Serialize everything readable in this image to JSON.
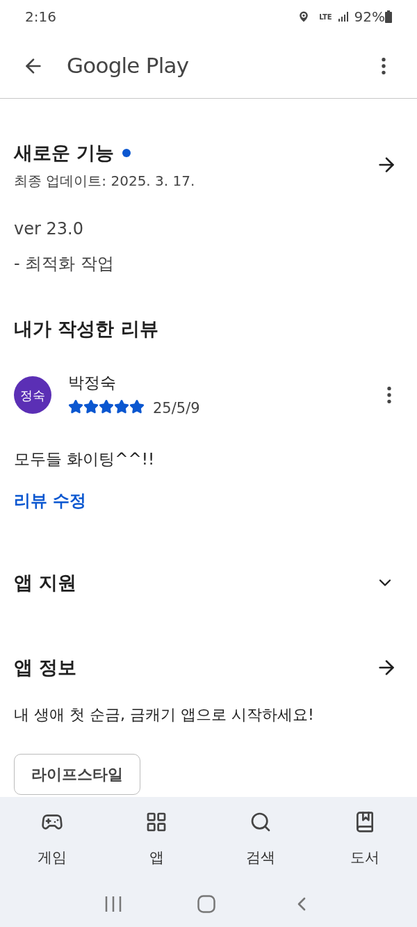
{
  "status_bar": {
    "time": "2:16",
    "network": "LTE",
    "battery": "92%"
  },
  "app_bar": {
    "title": "Google Play"
  },
  "whats_new": {
    "title": "새로운 기능",
    "new_dot": true,
    "updated": "최종 업데이트: 2025. 3. 17.",
    "version": "ver 23.0",
    "notes": "- 최적화 작업"
  },
  "my_review": {
    "title": "내가 작성한 리뷰",
    "avatar": "정숙",
    "author": "박정숙",
    "stars": 5,
    "date": "25/5/9",
    "text": "모두들 화이팅^^!!",
    "edit_link": "리뷰 수정"
  },
  "sections": [
    {
      "title": "앱 지원",
      "kind": "expand"
    },
    {
      "title": "앱 정보",
      "kind": "arrow"
    }
  ],
  "app_info": {
    "description": "내 생애 첫 순금, 금캐기 앱으로 시작하세요!",
    "tags": [
      "라이프스타일"
    ]
  },
  "bottom_nav": [
    {
      "label": "게임",
      "selected": false
    },
    {
      "label": "앱",
      "selected": false
    },
    {
      "label": "검색",
      "selected": false
    },
    {
      "label": "도서",
      "selected": false
    }
  ]
}
